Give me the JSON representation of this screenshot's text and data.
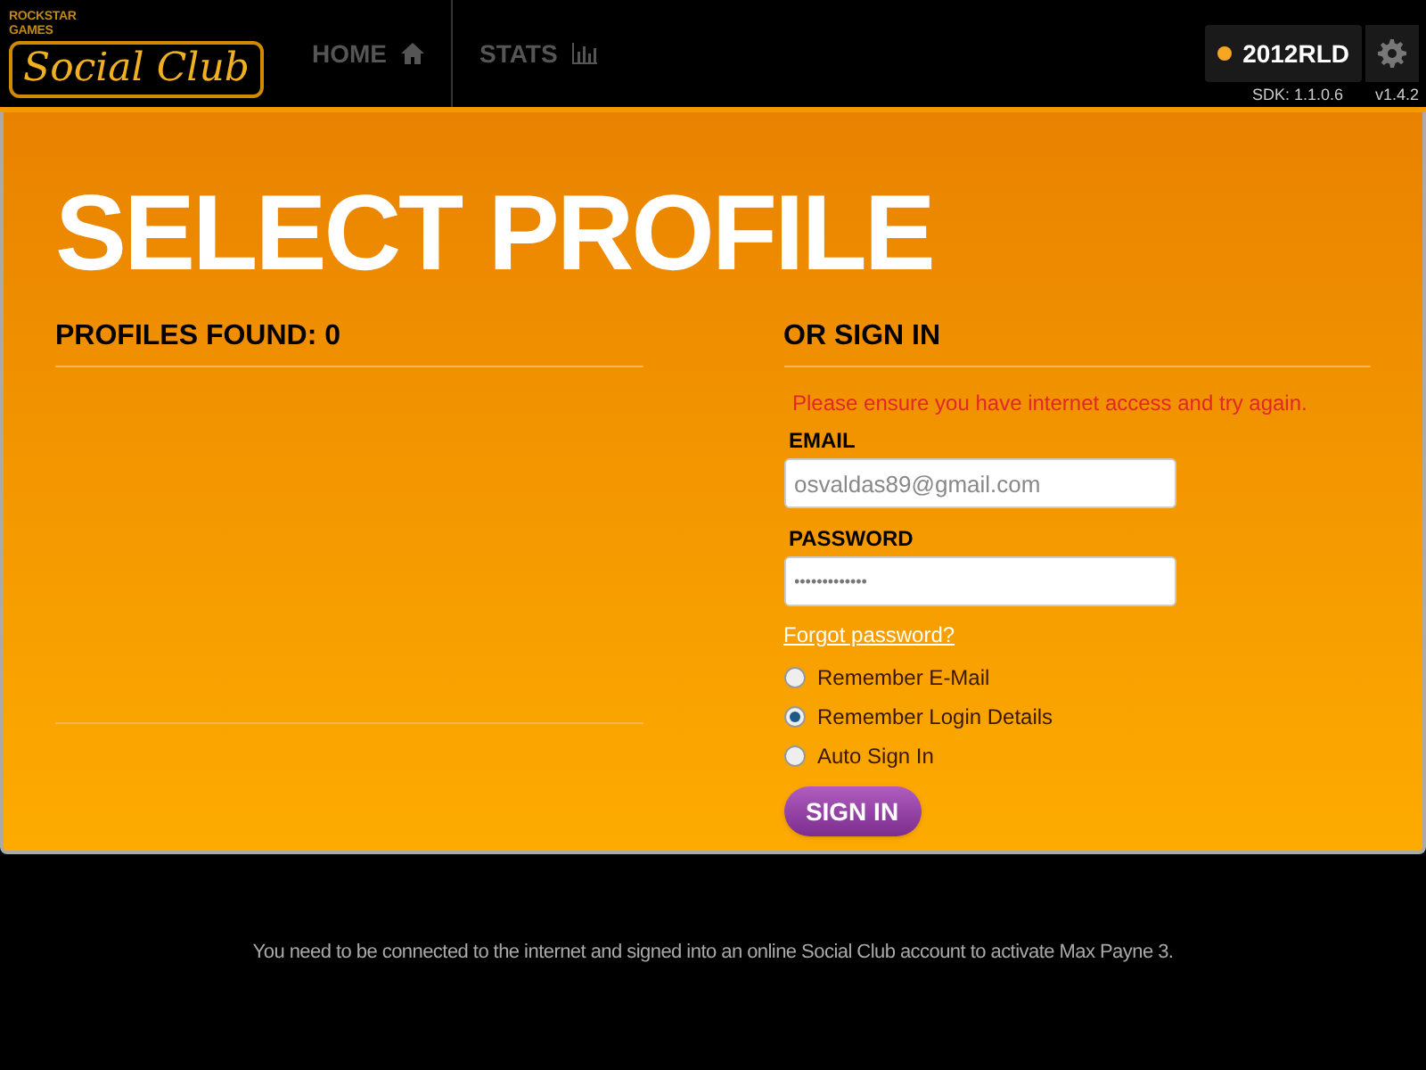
{
  "logo": {
    "publisher": "ROCKSTAR GAMES",
    "name": "Social Club"
  },
  "nav": [
    {
      "label": "HOME",
      "kind": "home"
    },
    {
      "label": "STATS",
      "kind": "stats"
    }
  ],
  "user": {
    "name": "2012RLD",
    "color": "#f5a623"
  },
  "versions": {
    "sdk": "SDK: 1.1.0.6",
    "app": "v1.4.2"
  },
  "title": "SELECT PROFILE",
  "profiles": {
    "heading": "PROFILES FOUND: 0"
  },
  "sign_in": {
    "heading": "OR SIGN IN",
    "error": "Please ensure you have internet access and try again.",
    "email": {
      "label": "EMAIL",
      "value": "osvaldas89@gmail.com"
    },
    "password": {
      "label": "PASSWORD",
      "value": "•••••••••••••"
    },
    "forgot": "Forgot password?",
    "options": [
      {
        "label": "Remember E-Mail",
        "selected": false
      },
      {
        "label": "Remember Login Details",
        "selected": true
      },
      {
        "label": "Auto Sign In",
        "selected": false
      }
    ],
    "button": "SIGN IN"
  },
  "footer": "You need to be connected to the internet and signed into an online Social Club account to activate Max Payne 3."
}
